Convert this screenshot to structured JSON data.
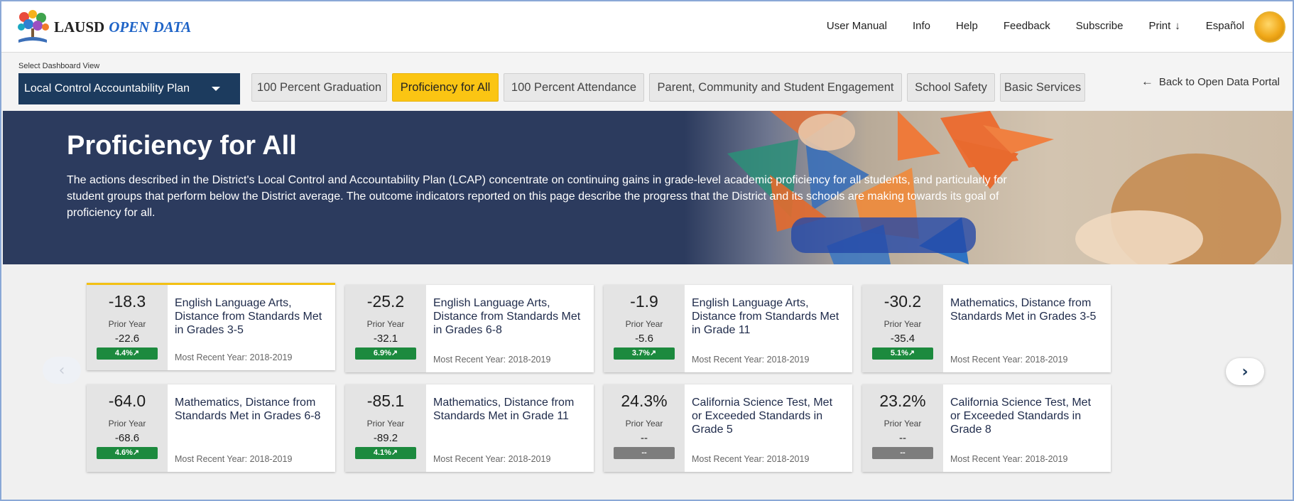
{
  "header": {
    "brand_prefix": "LAUSD",
    "brand_accent": "OPEN DATA",
    "nav": [
      "User Manual",
      "Info",
      "Help",
      "Feedback",
      "Subscribe",
      "Print",
      "Español"
    ],
    "print_arrow": "↓"
  },
  "selector": {
    "label": "Select Dashboard View",
    "value": "Local Control Accountability Plan"
  },
  "tabs": [
    {
      "label": "100 Percent Graduation",
      "active": false
    },
    {
      "label": "Proficiency for All",
      "active": true
    },
    {
      "label": "100 Percent Attendance",
      "active": false
    },
    {
      "label": "Parent, Community and Student Engagement",
      "active": false
    },
    {
      "label": "School Safety",
      "active": false
    },
    {
      "label": "Basic Services",
      "active": false
    }
  ],
  "back_link": "Back to Open Data Portal",
  "hero": {
    "title": "Proficiency for All",
    "text": "The actions described in the District's Local Control and Accountability Plan (LCAP) concentrate on continuing gains in grade-level academic proficiency for all students, and particularly for student groups that perform below the District average. The outcome indicators reported on this page describe the progress that the District and its schools are making towards its goal of proficiency for all."
  },
  "cards": [
    {
      "value": "-18.3",
      "prior_label": "Prior Year",
      "prior": "-22.6",
      "badge": "4.4%↗",
      "title": "English Language Arts, Distance from Standards Met in Grades 3-5",
      "recent": "Most Recent Year: 2018-2019"
    },
    {
      "value": "-25.2",
      "prior_label": "Prior Year",
      "prior": "-32.1",
      "badge": "6.9%↗",
      "title": "English Language Arts, Distance from Standards Met in Grades 6-8",
      "recent": "Most Recent Year: 2018-2019"
    },
    {
      "value": "-1.9",
      "prior_label": "Prior Year",
      "prior": "-5.6",
      "badge": "3.7%↗",
      "title": "English Language Arts, Distance from Standards Met in Grade 11",
      "recent": "Most Recent Year: 2018-2019"
    },
    {
      "value": "-30.2",
      "prior_label": "Prior Year",
      "prior": "-35.4",
      "badge": "5.1%↗",
      "title": "Mathematics, Distance from Standards Met in Grades 3-5",
      "recent": "Most Recent Year: 2018-2019"
    },
    {
      "value": "-64.0",
      "prior_label": "Prior Year",
      "prior": "-68.6",
      "badge": "4.6%↗",
      "title": "Mathematics, Distance from Standards Met in Grades 6-8",
      "recent": "Most Recent Year: 2018-2019"
    },
    {
      "value": "-85.1",
      "prior_label": "Prior Year",
      "prior": "-89.2",
      "badge": "4.1%↗",
      "title": "Mathematics, Distance from Standards Met in Grade 11",
      "recent": "Most Recent Year: 2018-2019"
    },
    {
      "value": "24.3%",
      "prior_label": "Prior Year",
      "prior": "--",
      "badge": "--",
      "title": "California Science Test, Met or Exceeded Standards in Grade 5",
      "recent": "Most Recent Year: 2018-2019"
    },
    {
      "value": "23.2%",
      "prior_label": "Prior Year",
      "prior": "--",
      "badge": "--",
      "title": "California Science Test, Met or Exceeded Standards in Grade 8",
      "recent": "Most Recent Year: 2018-2019"
    }
  ],
  "carousel": {
    "prev_icon": "‹",
    "next_icon": "›"
  },
  "colors": {
    "navy": "#1c3b5e",
    "active_tab": "#fbc513",
    "badge_up": "#1c8a3e",
    "badge_neutral": "#7d7d7d",
    "hero_bg": "#2c3b5e"
  }
}
